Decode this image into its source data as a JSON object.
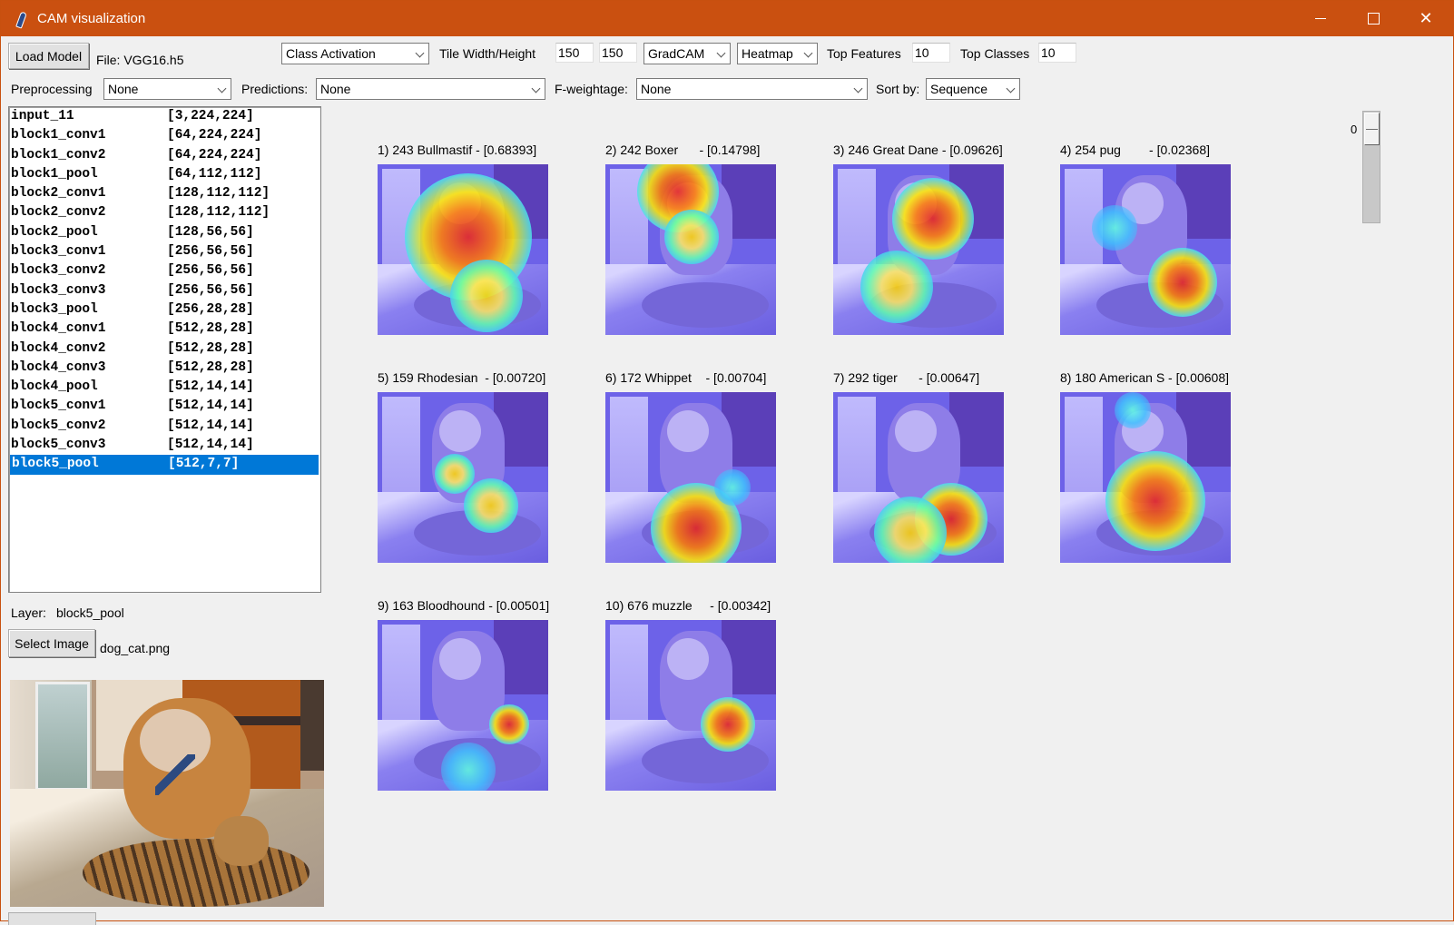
{
  "window": {
    "title": "CAM visualization",
    "icon": "feather-icon"
  },
  "toolbar": {
    "load_model_label": "Load Model",
    "file_label": "File: VGG16.h5",
    "mode_select": "Class Activation",
    "tile_size_label": "Tile Width/Height",
    "tile_width": "150",
    "tile_height": "150",
    "method_select": "GradCAM",
    "display_select": "Heatmap",
    "top_features_label": "Top Features",
    "top_features": "10",
    "top_classes_label": "Top Classes",
    "top_classes": "10",
    "preprocessing_label": "Preprocessing",
    "preprocessing_select": "None",
    "predictions_label": "Predictions:",
    "predictions_select": "None",
    "fweightage_label": "F-weightage:",
    "fweightage_select": "None",
    "sortby_label": "Sort by:",
    "sortby_select": "Sequence"
  },
  "layers": [
    {
      "name": "input_11",
      "shape": "[3,224,224]"
    },
    {
      "name": "block1_conv1",
      "shape": "[64,224,224]"
    },
    {
      "name": "block1_conv2",
      "shape": "[64,224,224]"
    },
    {
      "name": "block1_pool",
      "shape": "[64,112,112]"
    },
    {
      "name": "block2_conv1",
      "shape": "[128,112,112]"
    },
    {
      "name": "block2_conv2",
      "shape": "[128,112,112]"
    },
    {
      "name": "block2_pool",
      "shape": "[128,56,56]"
    },
    {
      "name": "block3_conv1",
      "shape": "[256,56,56]"
    },
    {
      "name": "block3_conv2",
      "shape": "[256,56,56]"
    },
    {
      "name": "block3_conv3",
      "shape": "[256,56,56]"
    },
    {
      "name": "block3_pool",
      "shape": "[256,28,28]"
    },
    {
      "name": "block4_conv1",
      "shape": "[512,28,28]"
    },
    {
      "name": "block4_conv2",
      "shape": "[512,28,28]"
    },
    {
      "name": "block4_conv3",
      "shape": "[512,28,28]"
    },
    {
      "name": "block4_pool",
      "shape": "[512,14,14]"
    },
    {
      "name": "block5_conv1",
      "shape": "[512,14,14]"
    },
    {
      "name": "block5_conv2",
      "shape": "[512,14,14]"
    },
    {
      "name": "block5_conv3",
      "shape": "[512,14,14]"
    },
    {
      "name": "block5_pool",
      "shape": "[512,7,7]",
      "selected": true
    }
  ],
  "layer_info": {
    "label": "Layer:",
    "value": "block5_pool"
  },
  "image": {
    "select_label": "Select Image",
    "filename": "dog_cat.png"
  },
  "slider": {
    "value": "0"
  },
  "tiles": [
    {
      "label": "1) 243 Bullmastif - [0.68393]"
    },
    {
      "label": "2) 242 Boxer      - [0.14798]"
    },
    {
      "label": "3) 246 Great Dane - [0.09626]"
    },
    {
      "label": "4) 254 pug        - [0.02368]"
    },
    {
      "label": "5) 159 Rhodesian  - [0.00720]"
    },
    {
      "label": "6) 172 Whippet    - [0.00704]"
    },
    {
      "label": "7) 292 tiger      - [0.00647]"
    },
    {
      "label": "8) 180 American S - [0.00608]"
    },
    {
      "label": "9) 163 Bloodhound - [0.00501]"
    },
    {
      "label": "10) 676 muzzle     - [0.00342]"
    }
  ]
}
